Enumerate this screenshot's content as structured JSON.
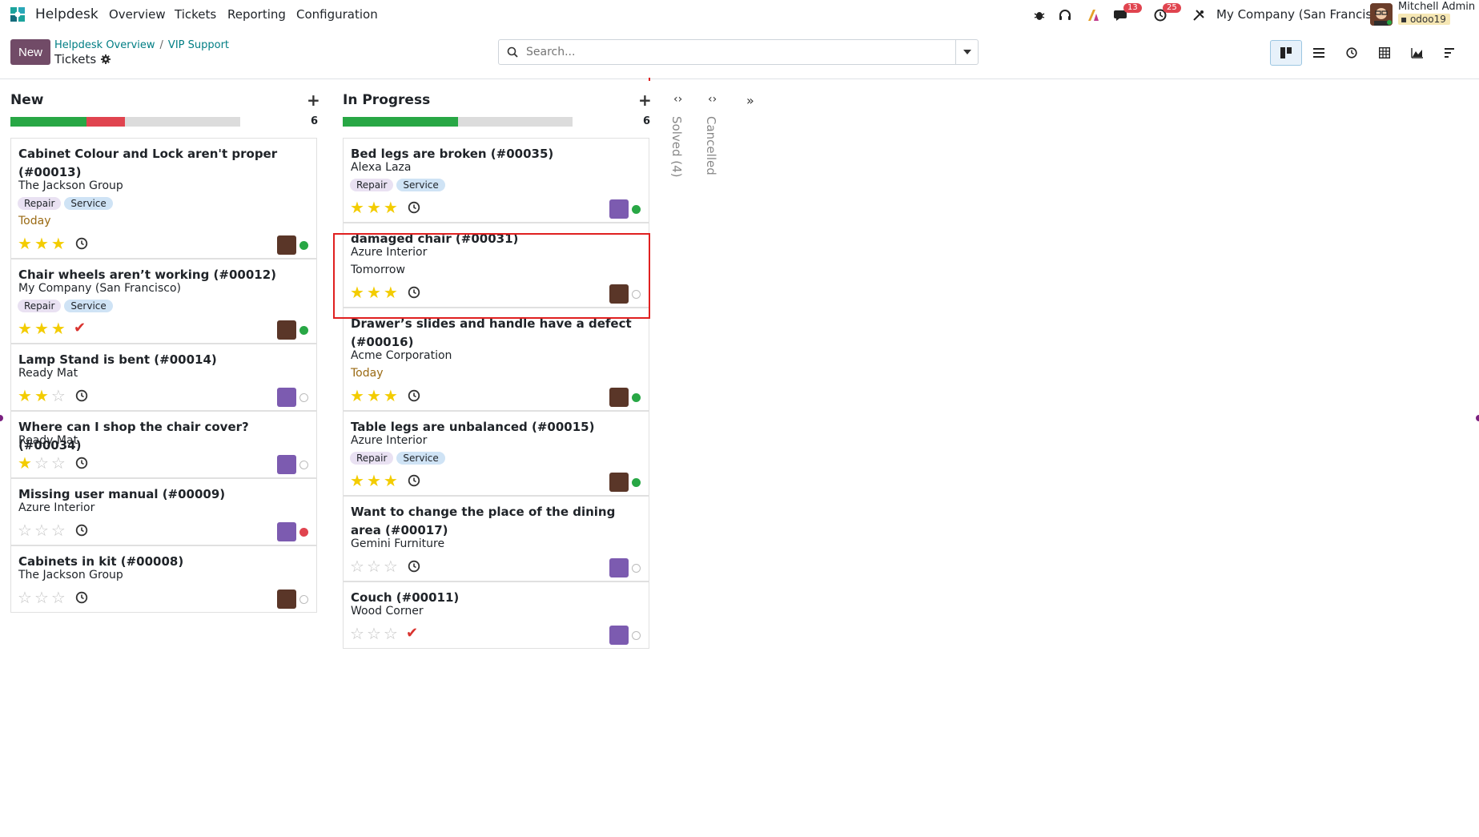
{
  "app": {
    "name": "Helpdesk"
  },
  "menu": {
    "overview": "Overview",
    "tickets": "Tickets",
    "reporting": "Reporting",
    "configuration": "Configuration"
  },
  "systray": {
    "messages_badge": "13",
    "activities_badge": "25",
    "company": "My Company (San Francisco)",
    "user_name": "Mitchell Admin",
    "database": "odoo19"
  },
  "control": {
    "new_label": "New",
    "breadcrumb": [
      "Helpdesk Overview",
      "VIP Support"
    ],
    "page_title": "Tickets",
    "search_placeholder": "Search..."
  },
  "colors": {
    "brand": "#714b67",
    "link": "#017e84",
    "star": "#f3cc00",
    "green": "#28a745",
    "red": "#e0444f"
  },
  "columns": [
    {
      "title": "New",
      "count": "6",
      "progress": {
        "green": 0.33,
        "red": 0.17
      },
      "cards": [
        {
          "title": "Cabinet Colour and Lock aren't proper (#00013)",
          "partner": "The Jackson Group",
          "tags": [
            "Repair",
            "Service"
          ],
          "deadline": "Today",
          "stars": 3,
          "activity": "clock",
          "status": "green"
        },
        {
          "title": "Chair wheels aren’t working (#00012)",
          "partner": "My Company (San Francisco)",
          "tags": [
            "Repair",
            "Service"
          ],
          "deadline": "",
          "stars": 3,
          "activity": "check",
          "status": "green"
        },
        {
          "title": "Lamp Stand is bent (#00014)",
          "partner": "Ready Mat",
          "tags": [],
          "deadline": "",
          "stars": 2,
          "activity": "clock",
          "status": "grey"
        },
        {
          "title": "Where can I shop the chair cover? (#00034)",
          "partner": "Ready Mat",
          "tags": [],
          "deadline": "",
          "stars": 1,
          "activity": "clock",
          "status": "grey"
        },
        {
          "title": "Missing user manual (#00009)",
          "partner": "Azure Interior",
          "tags": [],
          "deadline": "",
          "stars": 0,
          "activity": "clock",
          "status": "red"
        },
        {
          "title": "Cabinets in kit (#00008)",
          "partner": "The Jackson Group",
          "tags": [],
          "deadline": "",
          "stars": 0,
          "activity": "clock",
          "status": "grey"
        }
      ]
    },
    {
      "title": "In Progress",
      "count": "6",
      "progress": {
        "green": 0.5,
        "red": 0
      },
      "cards": [
        {
          "title": "Bed legs are broken (#00035)",
          "partner": "Alexa Laza",
          "tags": [
            "Repair",
            "Service"
          ],
          "deadline": "",
          "stars": 3,
          "activity": "clock",
          "status": "green"
        },
        {
          "title": "damaged chair (#00031)",
          "partner": "Azure Interior",
          "tags": [],
          "deadline": "Tomorrow",
          "stars": 3,
          "activity": "clock",
          "status": "grey"
        },
        {
          "title": "Drawer’s slides and handle have a defect (#00016)",
          "partner": "Acme Corporation",
          "tags": [],
          "deadline": "Today",
          "stars": 3,
          "activity": "clock",
          "status": "green"
        },
        {
          "title": "Table legs are unbalanced (#00015)",
          "partner": "Azure Interior",
          "tags": [
            "Repair",
            "Service"
          ],
          "deadline": "",
          "stars": 3,
          "activity": "clock",
          "status": "green"
        },
        {
          "title": "Want to change the place of the dining area (#00017)",
          "partner": "Gemini Furniture",
          "tags": [],
          "deadline": "",
          "stars": 0,
          "activity": "clock",
          "status": "grey"
        },
        {
          "title": "Couch (#00011)",
          "partner": "Wood Corner",
          "tags": [],
          "deadline": "",
          "stars": 0,
          "activity": "check",
          "status": "grey"
        }
      ]
    }
  ],
  "folded_columns": [
    "Solved (4)",
    "Cancelled"
  ]
}
